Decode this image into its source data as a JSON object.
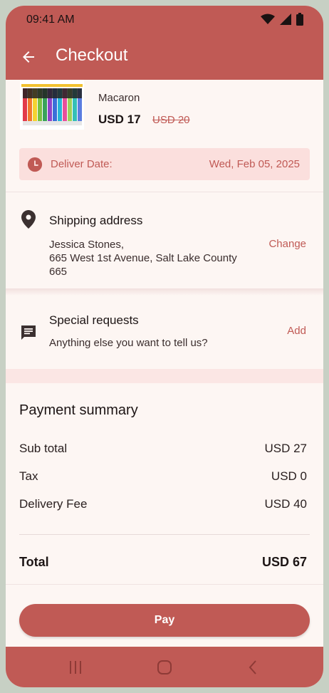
{
  "status_bar": {
    "time": "09:41 AM"
  },
  "app_bar": {
    "title": "Checkout"
  },
  "product": {
    "name": "Macaron",
    "price": "USD 17",
    "original_price": "USD 20"
  },
  "delivery": {
    "label": "Deliver Date:",
    "date": "Wed, Feb 05, 2025"
  },
  "shipping": {
    "heading": "Shipping address",
    "name_line": "Jessica Stones,",
    "address_line": "665 West 1st Avenue, Salt Lake County",
    "zip_line": "665",
    "action": "Change"
  },
  "requests": {
    "heading": "Special requests",
    "prompt": "Anything else you want to tell us?",
    "action": "Add"
  },
  "payment": {
    "heading": "Payment summary",
    "rows": [
      {
        "label": "Sub total",
        "value": "USD 27"
      },
      {
        "label": "Tax",
        "value": "USD 0"
      },
      {
        "label": "Delivery Fee",
        "value": "USD 40"
      }
    ],
    "total_label": "Total",
    "total_value": "USD 67"
  },
  "pay_button": {
    "label": "Pay"
  },
  "colors": {
    "accent": "#c05a55",
    "accent_light": "#fbdfdd",
    "background": "#fdf6f3"
  },
  "icons": [
    "back-arrow-icon",
    "clock-icon",
    "location-pin-icon",
    "chat-icon",
    "recents-icon",
    "home-icon",
    "nav-back-icon",
    "wifi-icon",
    "signal-icon",
    "battery-icon"
  ]
}
